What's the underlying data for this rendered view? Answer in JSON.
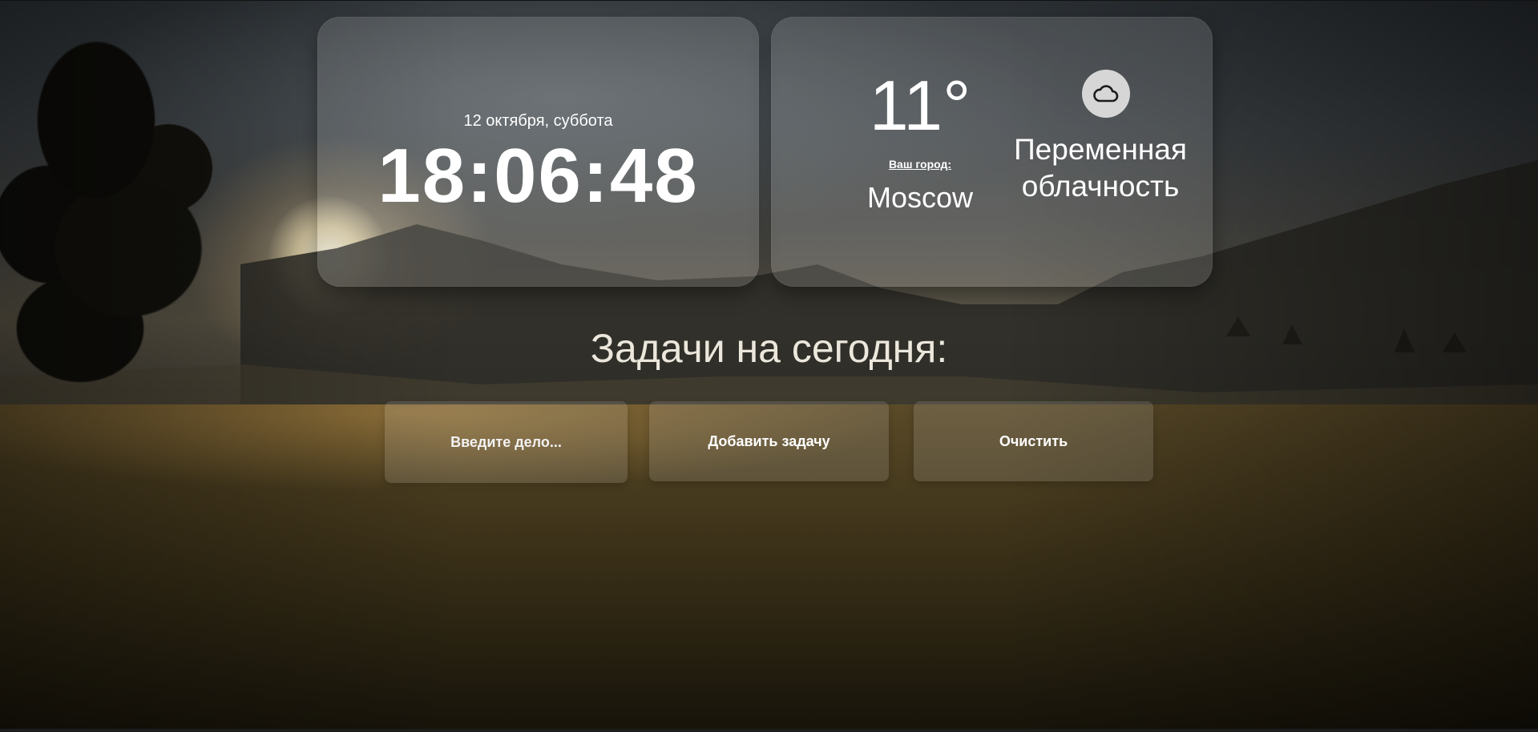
{
  "clock": {
    "date": "12 октября, суббота",
    "time": "18:06:48"
  },
  "weather": {
    "temperature": "11°",
    "city_caption": "Ваш город:",
    "city": "Moscow",
    "condition_line1": "Переменная",
    "condition_line2": "облачность",
    "icon": "cloud-icon"
  },
  "tasks": {
    "heading": "Задачи на сегодня:",
    "input_placeholder": "Введите дело...",
    "add_label": "Добавить задачу",
    "clear_label": "Очистить"
  }
}
